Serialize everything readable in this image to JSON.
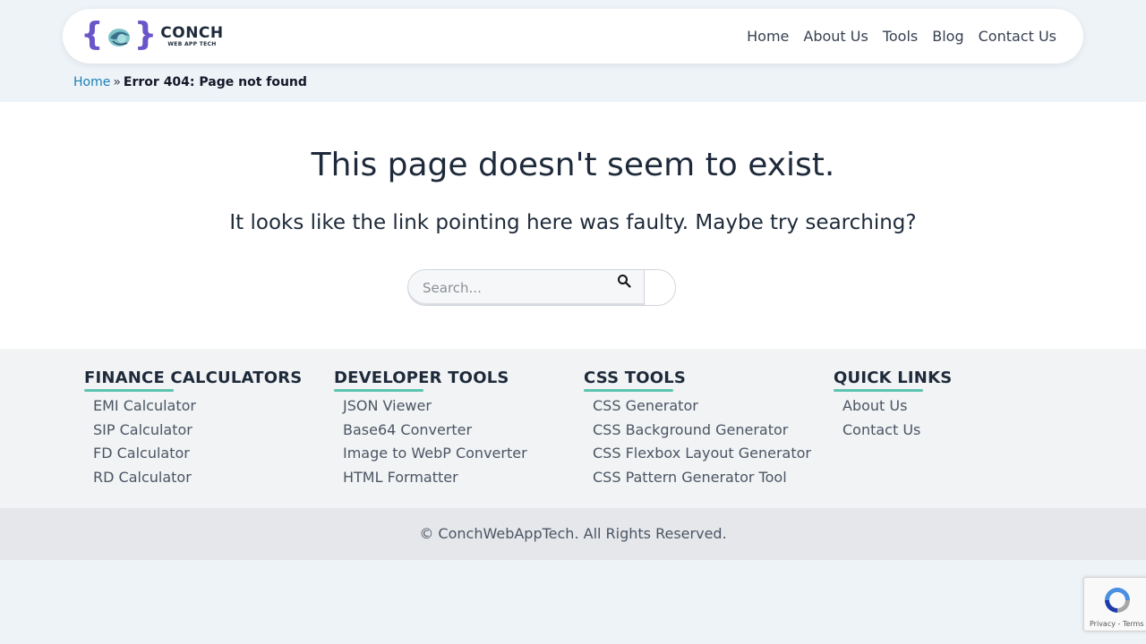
{
  "header": {
    "logo": {
      "main": "CONCH",
      "sub": "WEB APP TECH"
    },
    "nav": [
      {
        "label": "Home"
      },
      {
        "label": "About Us"
      },
      {
        "label": "Tools"
      },
      {
        "label": "Blog"
      },
      {
        "label": "Contact Us"
      }
    ]
  },
  "breadcrumb": {
    "home": "Home",
    "separator": "»",
    "current": "Error 404: Page not found"
  },
  "main": {
    "title": "This page doesn't seem to exist.",
    "subtitle": "It looks like the link pointing here was faulty. Maybe try searching?",
    "search": {
      "placeholder": "Search..."
    }
  },
  "footer": {
    "columns": [
      {
        "title": "FINANCE CALCULATORS",
        "links": [
          "EMI Calculator",
          "SIP Calculator",
          "FD Calculator",
          "RD Calculator"
        ]
      },
      {
        "title": "DEVELOPER TOOLS",
        "links": [
          "JSON Viewer",
          "Base64 Converter",
          "Image to WebP Converter",
          "HTML Formatter"
        ]
      },
      {
        "title": "CSS TOOLS",
        "links": [
          "CSS Generator",
          "CSS Background Generator",
          "CSS Flexbox Layout Generator",
          "CSS Pattern Generator Tool"
        ]
      },
      {
        "title": "QUICK LINKS",
        "links": [
          "About Us",
          "Contact Us"
        ]
      }
    ],
    "copyright": "© ConchWebAppTech. All Rights Reserved."
  },
  "recaptcha": {
    "links": "Privacy - Terms"
  },
  "colors": {
    "accent_underline": "#5cc3b0",
    "link": "#1a7fb5",
    "logo_brace": "#6a55c9"
  }
}
